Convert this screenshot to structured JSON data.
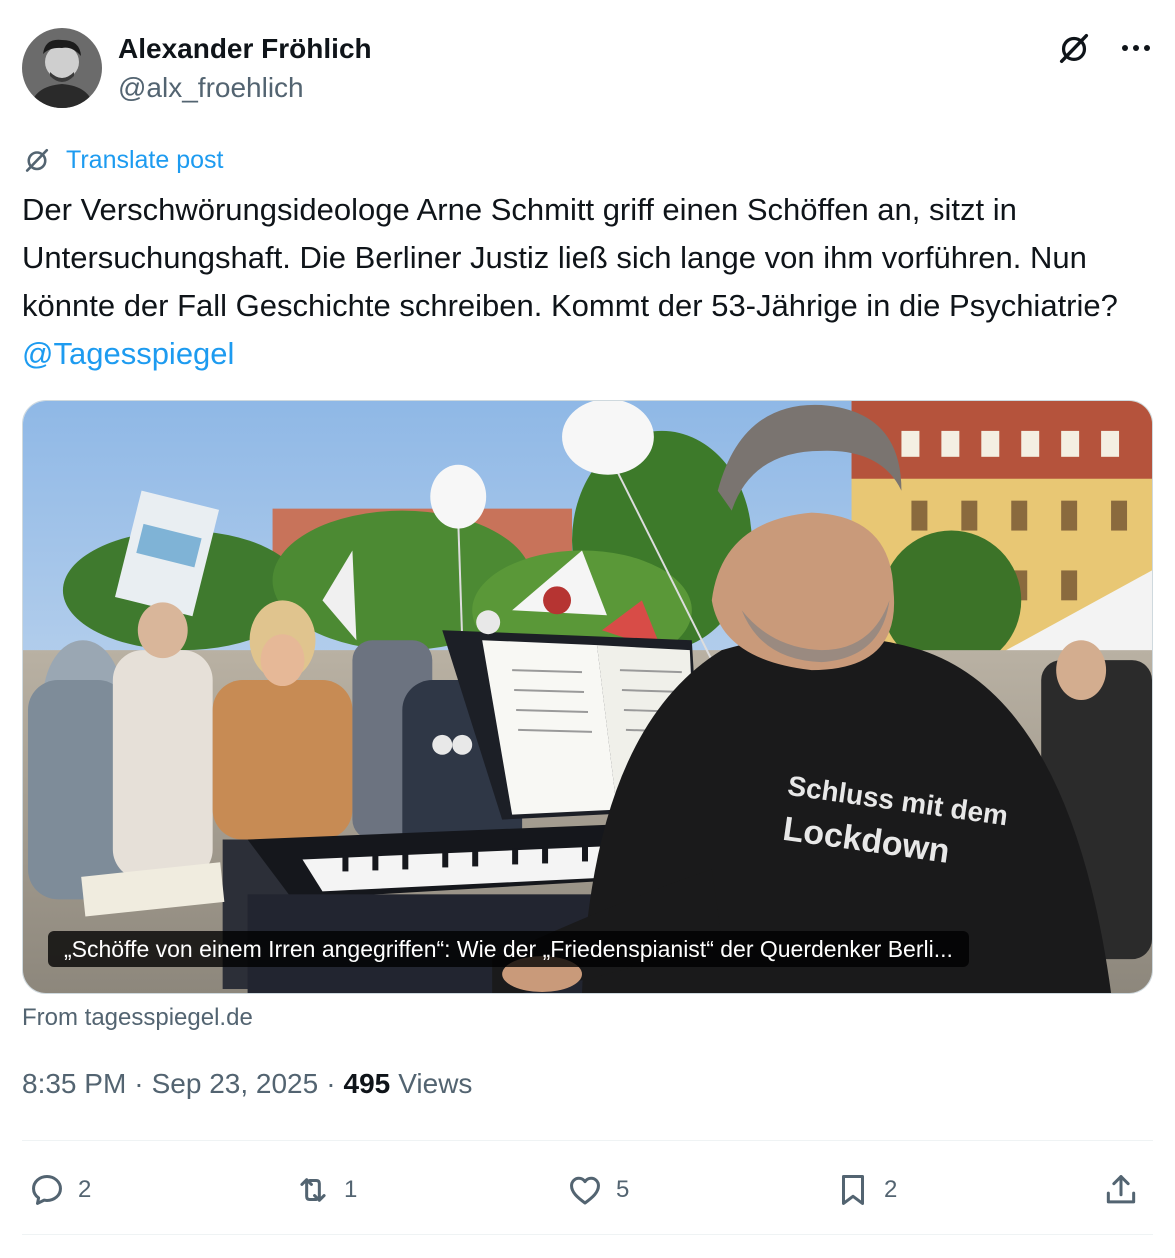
{
  "author": {
    "name": "Alexander Fröhlich",
    "handle": "@alx_froehlich"
  },
  "header_icons": [
    "grok-icon",
    "more-icon"
  ],
  "translate": {
    "label": "Translate post"
  },
  "post": {
    "text": "Der Verschwörungsideologe Arne Schmitt griff einen Schöffen an, sitzt in Untersuchungshaft. Die Berliner Justiz ließ sich lange von ihm vorführen. Nun könnte der Fall Geschichte schreiben. Kommt der 53-Jährige in die Psychiatrie? ",
    "mention": "@Tagesspiegel"
  },
  "link_card": {
    "title": "„Schöffe von einem Irren angegriffen“: Wie der „Friedenspianist“ der Querdenker Berli...",
    "source": "From tagesspiegel.de",
    "photo_text": {
      "hoodie_line1": "Schluss mit dem",
      "hoodie_line2": "Lockdown"
    }
  },
  "meta": {
    "time": "8:35 PM",
    "separator1": "·",
    "date": "Sep 23, 2025",
    "separator2": "·",
    "views_count": "495",
    "views_label": "Views"
  },
  "actions": {
    "reply": "2",
    "repost": "1",
    "like": "5",
    "bookmark": "2"
  },
  "colors": {
    "accent": "#1d9bf0",
    "text": "#0f1419",
    "secondary": "#536471",
    "border": "#cfd9de"
  }
}
